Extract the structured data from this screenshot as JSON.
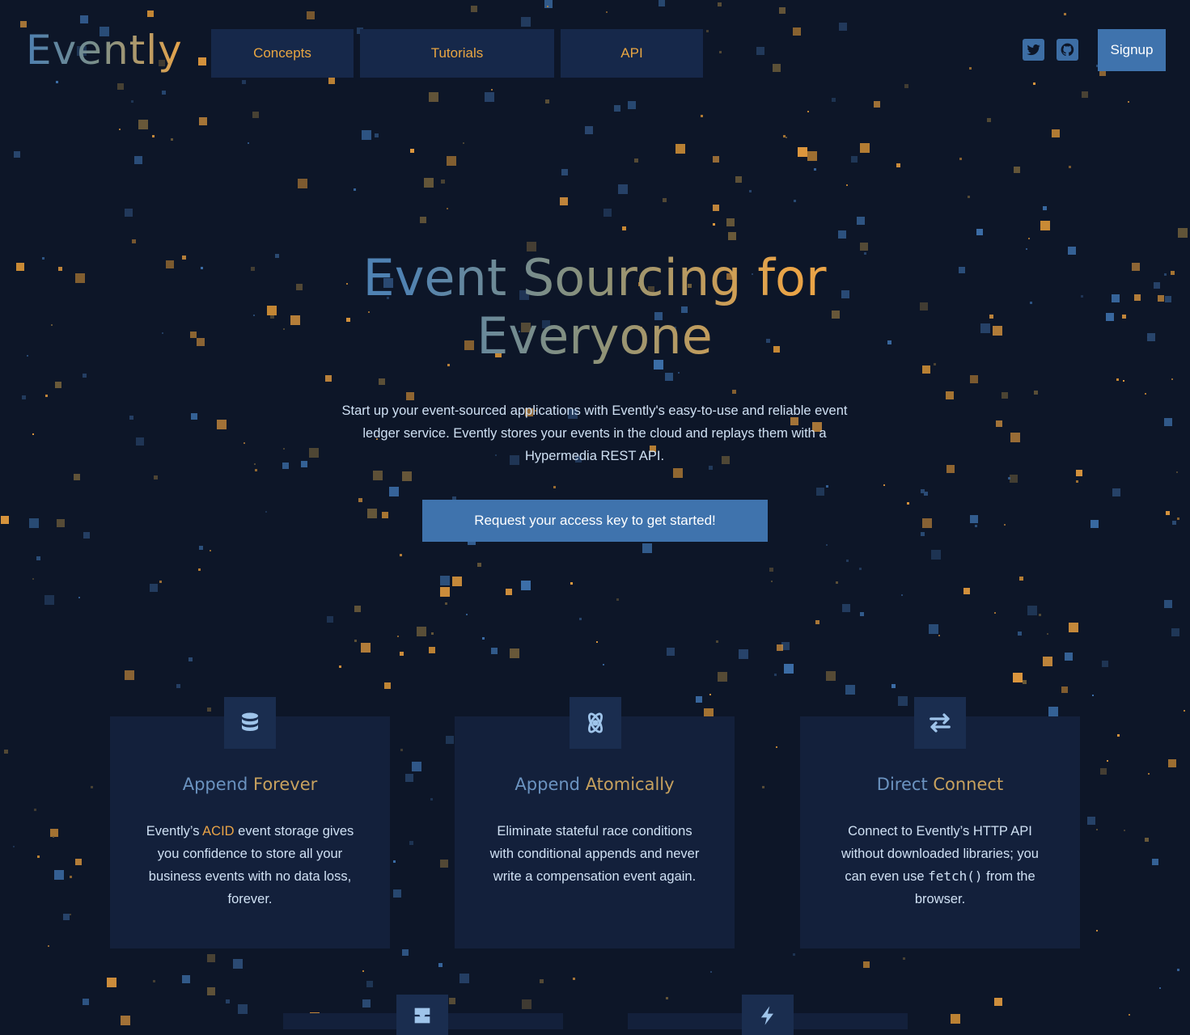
{
  "brand": {
    "logo_text": "Evently",
    "colors": {
      "background": "#0d1628",
      "accent_blue": "#3f73ad",
      "accent_orange": "#eaa447",
      "nav_bg": "#16284a",
      "card_bg": "#13203b"
    }
  },
  "nav": {
    "items": [
      {
        "label": "Concepts"
      },
      {
        "label": "Tutorials"
      },
      {
        "label": "API"
      }
    ]
  },
  "header": {
    "social": [
      {
        "icon": "twitter-icon"
      },
      {
        "icon": "github-icon"
      }
    ],
    "signup_label": "Signup"
  },
  "hero": {
    "title_line1": "Event Sourcing for",
    "title_line2": "Everyone",
    "description": "Start up your event-sourced applications with Evently's easy-to-use and reliable event ledger service. Evently stores your events in the cloud and replays them with a Hypermedia REST API.",
    "cta_label": "Request your access key to get started!"
  },
  "features": [
    {
      "icon": "database-icon",
      "title_a": "Append ",
      "title_b": "Forever",
      "text_before": "Evently’s ",
      "text_highlight": "ACID",
      "text_after": " event storage gives you confidence to store all your business events with no data loss, forever."
    },
    {
      "icon": "atom-icon",
      "title_a": "Append ",
      "title_b": "Atomically",
      "text": "Eliminate stateful race conditions with conditional appends and never write a compensation event again."
    },
    {
      "icon": "exchange-arrows-icon",
      "title_a": "Direct ",
      "title_b": "Connect",
      "text_before": "Connect to Evently’s HTTP API without downloaded libraries; you can even use ",
      "text_code": "fetch()",
      "text_after": " from the browser."
    }
  ],
  "features_row2": [
    {
      "icon": "inbox-icon"
    },
    {
      "icon": "bolt-icon"
    }
  ]
}
